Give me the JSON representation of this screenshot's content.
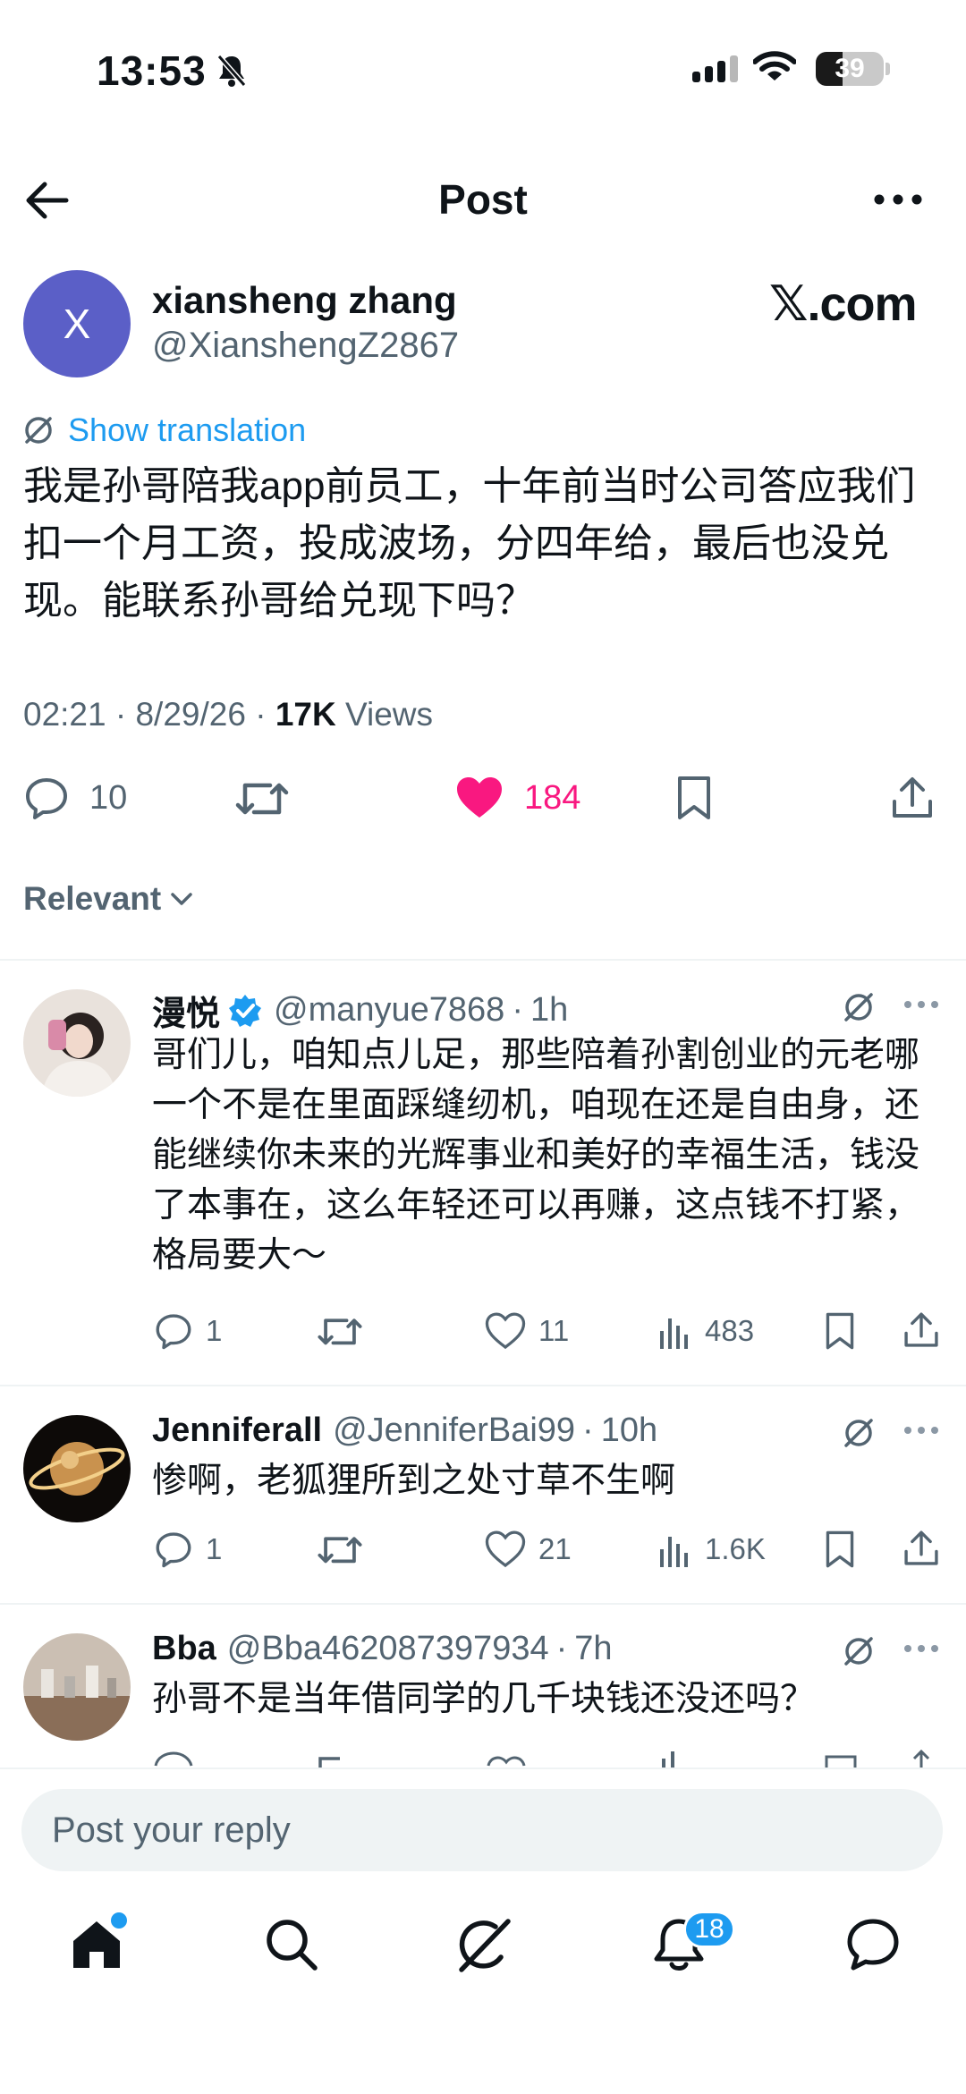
{
  "status_bar": {
    "time": "13:53",
    "battery": "39",
    "battery_level": 0.39
  },
  "header": {
    "title": "Post"
  },
  "brand_tag": "𝕏.com",
  "post": {
    "author_avatar_letter": "X",
    "author_name": "xiansheng zhang",
    "author_handle": "@XianshengZ2867",
    "translation_link": "Show translation",
    "text": "我是孙哥陪我app前员工，十年前当时公司答应我们扣一个月工资，投成波场，分四年给，最后也没兑现。能联系孙哥给兑现下吗？",
    "timestamp": "02:21 · 8/29/26 · ",
    "views_count": "17K",
    "views_label": " Views",
    "reply_count": "10",
    "like_count": "184",
    "liked": true
  },
  "sort": {
    "label": "Relevant"
  },
  "replies": [
    {
      "name": "漫悦",
      "verified": true,
      "handle": "@manyue7868",
      "time": "1h",
      "text": "哥们儿，咱知点儿足，那些陪着孙割创业的元老哪一个不是在里面踩缝纫机，咱现在还是自由身，还能继续你未来的光辉事业和美好的幸福生活，钱没了本事在，这么年轻还可以再赚，这点钱不打紧，格局要大～",
      "replies": "1",
      "likes": "11",
      "views": "483"
    },
    {
      "name": "Jenniferall",
      "verified": false,
      "handle": "@JenniferBai99",
      "time": "10h",
      "text": "惨啊，老狐狸所到之处寸草不生啊",
      "replies": "1",
      "likes": "21",
      "views": "1.6K"
    },
    {
      "name": "Bba",
      "verified": false,
      "handle": "@Bba462087397934",
      "time": "7h",
      "text": "孙哥不是当年借同学的几千块钱还没还吗？"
    }
  ],
  "reply_bar": {
    "placeholder": "Post your reply"
  },
  "nav": {
    "notifications_badge": "18"
  },
  "colors": {
    "accent": "#1d9bf0",
    "like": "#f91880",
    "secondary_text": "#536471"
  }
}
